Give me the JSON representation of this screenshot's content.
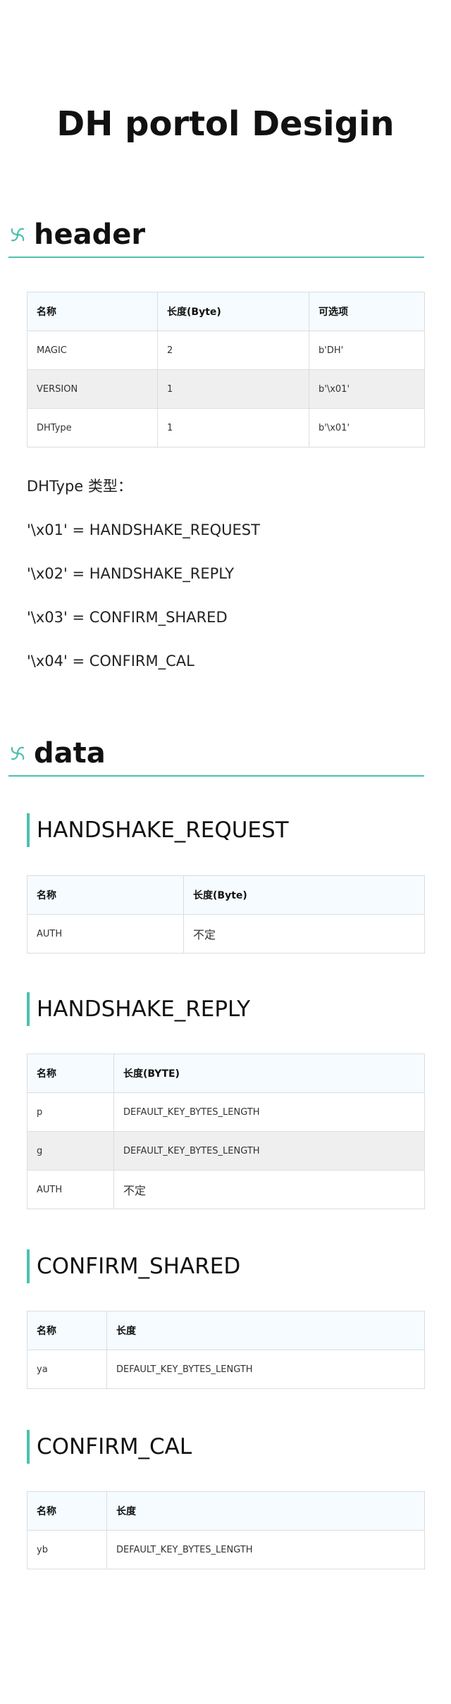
{
  "document": {
    "title": "DH portol Desigin"
  },
  "sections": {
    "header": {
      "heading": "header",
      "table": {
        "columns": [
          "名称",
          "长度(Byte)",
          "可选项"
        ],
        "rows": [
          [
            "MAGIC",
            "2",
            "b'DH'"
          ],
          [
            "VERSION",
            "1",
            "b'\\x01'"
          ],
          [
            "DHType",
            "1",
            "b'\\x01'"
          ]
        ]
      },
      "paragraphs": [
        "DHType 类型：",
        "'\\x01' = HANDSHAKE_REQUEST",
        "'\\x02' = HANDSHAKE_REPLY",
        "'\\x03' = CONFIRM_SHARED",
        "'\\x04' = CONFIRM_CAL"
      ]
    },
    "data": {
      "heading": "data",
      "subsections": [
        {
          "heading": "HANDSHAKE_REQUEST",
          "columns": [
            "名称",
            "长度(Byte)"
          ],
          "rows": [
            [
              "AUTH",
              "不定"
            ]
          ]
        },
        {
          "heading": "HANDSHAKE_REPLY",
          "columns": [
            "名称",
            "长度(BYTE)"
          ],
          "rows": [
            [
              "p",
              "DEFAULT_KEY_BYTES_LENGTH"
            ],
            [
              "g",
              "DEFAULT_KEY_BYTES_LENGTH"
            ],
            [
              "AUTH",
              "不定"
            ]
          ]
        },
        {
          "heading": "CONFIRM_SHARED",
          "columns": [
            "名称",
            "长度"
          ],
          "rows": [
            [
              "ya",
              "DEFAULT_KEY_BYTES_LENGTH"
            ]
          ]
        },
        {
          "heading": "CONFIRM_CAL",
          "columns": [
            "名称",
            "长度"
          ],
          "rows": [
            [
              "yb",
              "DEFAULT_KEY_BYTES_LENGTH"
            ]
          ]
        }
      ]
    }
  },
  "icons": {
    "heading_icon": "pinwheel-icon"
  },
  "colors": {
    "accent": "#4cc1ae",
    "table_header_bg": "#f5fbfe",
    "table_alt_row_bg": "#efefef",
    "table_border": "#d9dde3"
  }
}
